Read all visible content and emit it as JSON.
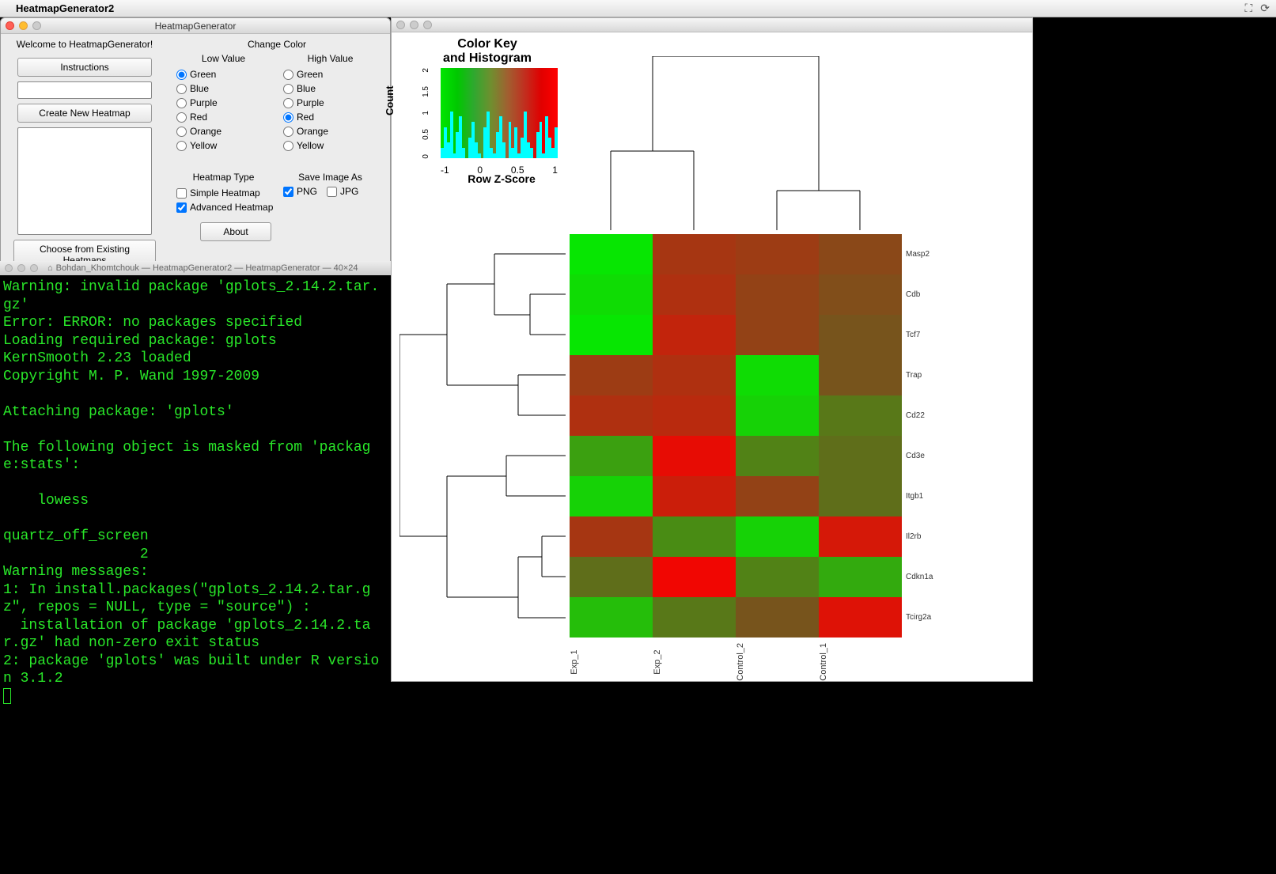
{
  "menubar": {
    "app_name": "HeatmapGenerator2"
  },
  "ctl": {
    "title": "HeatmapGenerator",
    "welcome": "Welcome to HeatmapGenerator!",
    "instructions_btn": "Instructions",
    "create_btn": "Create New Heatmap",
    "choose_btn": "Choose from Existing Heatmaps",
    "change_color": "Change Color",
    "low_value": "Low Value",
    "high_value": "High Value",
    "colors": [
      "Green",
      "Blue",
      "Purple",
      "Red",
      "Orange",
      "Yellow"
    ],
    "low_selected": "Green",
    "high_selected": "Red",
    "heatmap_type": "Heatmap Type",
    "simple": "Simple Heatmap",
    "advanced": "Advanced Heatmap",
    "simple_checked": false,
    "advanced_checked": true,
    "save_as": "Save Image As",
    "png": "PNG",
    "jpg": "JPG",
    "png_checked": true,
    "jpg_checked": false,
    "about_btn": "About"
  },
  "terminal": {
    "title": "Bohdan_Khomtchouk — HeatmapGenerator2 — HeatmapGenerator — 40×24",
    "content": "Warning: invalid package 'gplots_2.14.2.tar.gz'\nError: ERROR: no packages specified\nLoading required package: gplots\nKernSmooth 2.23 loaded\nCopyright M. P. Wand 1997-2009\n\nAttaching package: 'gplots'\n\nThe following object is masked from 'package:stats':\n\n    lowess\n\nquartz_off_screen \n                2 \nWarning messages:\n1: In install.packages(\"gplots_2.14.2.tar.gz\", repos = NULL, type = \"source\") :\n  installation of package 'gplots_2.14.2.tar.gz' had non-zero exit status\n2: package 'gplots' was built under R version 3.1.2"
  },
  "chart_data": {
    "type": "heatmap",
    "title_colorkey": "Color Key\nand Histogram",
    "colorkey_ylabel": "Count",
    "colorkey_xlabel": "Row Z-Score",
    "colorkey_xticks": [
      "-1",
      "0",
      "0.5",
      "1"
    ],
    "colorkey_yticks": [
      "0",
      "0.5",
      "1",
      "1.5",
      "2"
    ],
    "columns": [
      "Exp_1",
      "Exp_2",
      "Control_2",
      "Control_1"
    ],
    "rows": [
      "Masp2",
      "Cdb",
      "Tcf7",
      "Trap",
      "Cd22",
      "Cd3e",
      "Itgb1",
      "Il2rb",
      "Cdkn1a",
      "Tcirg2a"
    ],
    "z_scores": [
      [
        -1.4,
        0.6,
        0.5,
        0.3
      ],
      [
        -1.3,
        0.7,
        0.4,
        0.2
      ],
      [
        -1.4,
        0.9,
        0.4,
        0.1
      ],
      [
        0.5,
        0.7,
        -1.3,
        0.1
      ],
      [
        0.7,
        0.8,
        -1.2,
        -0.3
      ],
      [
        -0.7,
        1.3,
        -0.4,
        -0.2
      ],
      [
        -1.2,
        1.0,
        0.4,
        -0.2
      ],
      [
        0.6,
        -0.5,
        -1.2,
        1.1
      ],
      [
        -0.2,
        1.4,
        -0.4,
        -0.8
      ],
      [
        -1.0,
        -0.3,
        0.1,
        1.2
      ]
    ],
    "histogram_bins": [
      0.2,
      0.6,
      0.3,
      0.9,
      0.1,
      0.5,
      0.8,
      0.2,
      0.0,
      0.4,
      0.7,
      0.3,
      0.1,
      0.0,
      0.6,
      0.9,
      0.2,
      0.1,
      0.5,
      0.8,
      0.3,
      0.0,
      0.7,
      0.2,
      0.6,
      0.1,
      0.4,
      0.9,
      0.3,
      0.2,
      0.0,
      0.5,
      0.7,
      0.1,
      0.8,
      0.4,
      0.2,
      0.6
    ],
    "colorscale": {
      "low": "#00d600",
      "mid": "#6b6b2b",
      "high": "#e80000"
    }
  }
}
